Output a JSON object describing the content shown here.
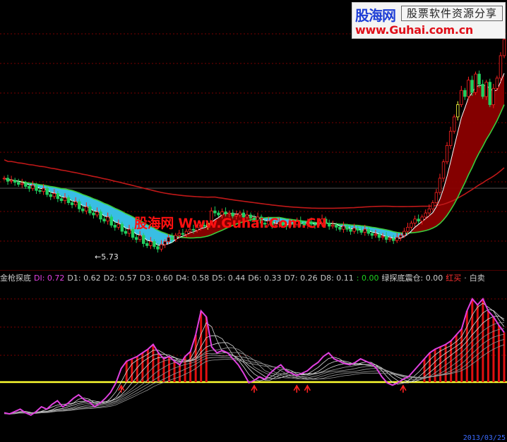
{
  "logo": {
    "brand": "股海网",
    "tagline": "股票软件资源分享",
    "url": "www.Guhai.com.cn"
  },
  "watermark": "股海网 Www.Guhai.Com.CN",
  "main_chart": {
    "low_label": "←5.73"
  },
  "indicator": {
    "header": [
      {
        "id": "name",
        "text": "金枪探底",
        "color": "#c8c8c8"
      },
      {
        "id": "di",
        "text": "DI: 0.72",
        "color": "#e040e0"
      },
      {
        "id": "d1",
        "text": "D1: 0.62",
        "color": "#c8c8c8"
      },
      {
        "id": "d2",
        "text": "D2: 0.57",
        "color": "#c8c8c8"
      },
      {
        "id": "d3",
        "text": "D3: 0.60",
        "color": "#c8c8c8"
      },
      {
        "id": "d4",
        "text": "D4: 0.58",
        "color": "#c8c8c8"
      },
      {
        "id": "d5",
        "text": "D5: 0.44",
        "color": "#c8c8c8"
      },
      {
        "id": "d6",
        "text": "D6: 0.33",
        "color": "#c8c8c8"
      },
      {
        "id": "d7",
        "text": "D7: 0.26",
        "color": "#c8c8c8"
      },
      {
        "id": "d8",
        "text": "D8: 0.11",
        "color": "#c8c8c8"
      },
      {
        "id": "zero",
        "text": ": 0.00",
        "color": "#20d020"
      },
      {
        "id": "lvt",
        "text": "绿探底震仓: 0.00",
        "color": "#d0d0d0"
      },
      {
        "id": "buy",
        "text": "红买",
        "color": "#ff3030"
      },
      {
        "id": "sep",
        "text": "·",
        "color": "#c8c8c8"
      },
      {
        "id": "sell",
        "text": "白卖",
        "color": "#c8c8c8"
      }
    ],
    "bottom_date": "2013/03/25"
  },
  "chart_data": [
    {
      "type": "candlestick",
      "series": [
        {
          "name": "price",
          "values": [
            9.2,
            9.05,
            9.1,
            9.0,
            8.9,
            8.95,
            8.8,
            8.7,
            8.85,
            8.6,
            8.55,
            8.7,
            8.4,
            8.3,
            8.45,
            8.2,
            8.1,
            8.25,
            8.0,
            7.9,
            8.05,
            7.7,
            7.6,
            7.8,
            7.5,
            7.4,
            7.55,
            7.2,
            7.1,
            7.3,
            6.9,
            6.8,
            6.95,
            6.6,
            6.5,
            6.7,
            6.3,
            6.2,
            6.4,
            6.0,
            5.9,
            6.1,
            5.85,
            5.73,
            5.95,
            6.1,
            6.3,
            6.2,
            6.4,
            6.5,
            6.45,
            6.6,
            6.7,
            6.65,
            6.8,
            6.9,
            6.85,
            7.0,
            7.6,
            7.5,
            7.4,
            7.55,
            7.45,
            7.5,
            7.35,
            7.4,
            7.5,
            7.3,
            7.4,
            7.25,
            7.15,
            7.3,
            7.0,
            6.95,
            7.1,
            6.9,
            6.95,
            7.05,
            6.9,
            6.85,
            7.0,
            6.95,
            7.1,
            7.0,
            6.9,
            7.05,
            6.95,
            6.9,
            7.0,
            7.2,
            7.0,
            6.85,
            6.9,
            6.8,
            6.7,
            6.85,
            6.7,
            6.6,
            6.75,
            6.65,
            6.55,
            6.7,
            6.5,
            6.4,
            6.45,
            6.3,
            6.35,
            6.2,
            6.25,
            6.15,
            6.3,
            6.4,
            6.6,
            6.8,
            7.0,
            7.2,
            7.1,
            7.3,
            7.5,
            7.7,
            8.0,
            8.5,
            9.2,
            10.0,
            10.8,
            11.5,
            12.2,
            12.8,
            13.5,
            13.2,
            14.0,
            13.4,
            14.3,
            13.8,
            13.2,
            13.9,
            12.8,
            13.6,
            14.1,
            15.2,
            16.0
          ]
        }
      ]
    },
    {
      "type": "line",
      "series": [
        {
          "name": "DI",
          "values": [
            0.05,
            0.04,
            0.06,
            0.08,
            0.05,
            0.03,
            0.06,
            0.1,
            0.08,
            0.12,
            0.15,
            0.1,
            0.13,
            0.17,
            0.2,
            0.16,
            0.14,
            0.1,
            0.13,
            0.17,
            0.22,
            0.3,
            0.42,
            0.48,
            0.5,
            0.52,
            0.55,
            0.58,
            0.62,
            0.55,
            0.5,
            0.52,
            0.48,
            0.45,
            0.52,
            0.56,
            0.7,
            0.9,
            0.85,
            0.6,
            0.55,
            0.57,
            0.55,
            0.5,
            0.45,
            0.38,
            0.3,
            0.32,
            0.35,
            0.33,
            0.38,
            0.42,
            0.45,
            0.4,
            0.38,
            0.36,
            0.38,
            0.4,
            0.44,
            0.47,
            0.52,
            0.55,
            0.5,
            0.48,
            0.46,
            0.45,
            0.47,
            0.5,
            0.48,
            0.46,
            0.42,
            0.35,
            0.3,
            0.28,
            0.3,
            0.33,
            0.35,
            0.4,
            0.45,
            0.5,
            0.55,
            0.58,
            0.6,
            0.62,
            0.65,
            0.7,
            0.75,
            0.9,
            1.0,
            0.95,
            1.0,
            0.9,
            0.85,
            0.78,
            0.72
          ]
        }
      ]
    }
  ]
}
